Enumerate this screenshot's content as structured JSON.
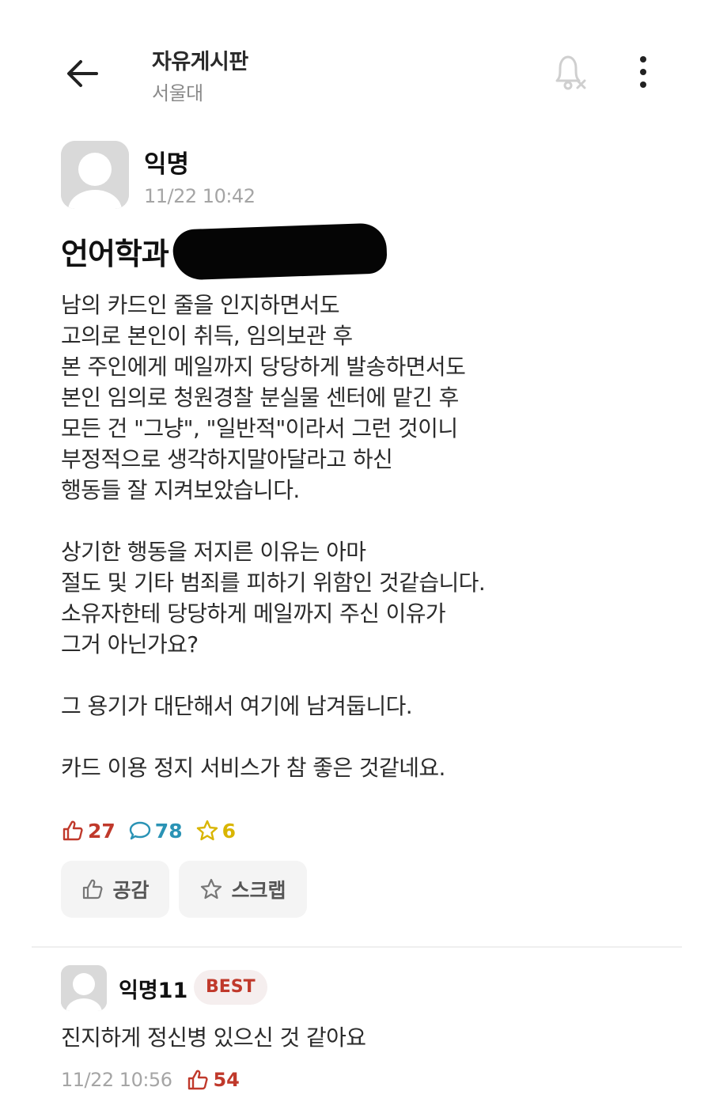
{
  "header": {
    "board_title": "자유게시판",
    "school": "서울대"
  },
  "post": {
    "author": "익명",
    "time": "11/22 10:42",
    "title_visible": "언어학과",
    "body_paragraphs": [
      [
        "남의 카드인 줄을 인지하면서도",
        "고의로 본인이 취득, 임의보관 후",
        "본 주인에게 메일까지 당당하게 발송하면서도",
        "본인 임의로 청원경찰 분실물 센터에 맡긴 후",
        "모든 건 \"그냥\", \"일반적\"이라서 그런 것이니",
        "부정적으로 생각하지말아달라고 하신",
        "행동들 잘 지켜보았습니다."
      ],
      [
        "상기한 행동을 저지른 이유는 아마",
        "절도 및 기타 범죄를 피하기 위함인 것같습니다.",
        "소유자한테 당당하게 메일까지 주신 이유가",
        "그거 아닌가요?"
      ],
      [
        "그 용기가 대단해서 여기에 남겨둡니다."
      ],
      [
        "카드 이용 정지 서비스가 참 좋은 것같네요."
      ]
    ],
    "stats": {
      "likes": "27",
      "comments": "78",
      "scraps": "6"
    }
  },
  "actions": {
    "like_label": "공감",
    "scrap_label": "스크랩"
  },
  "comment": {
    "author": "익명11",
    "badge": "BEST",
    "text": "진지하게 정신병 있으신 것 같아요",
    "time": "11/22 10:56",
    "likes": "54"
  },
  "colors": {
    "like": "#c0392b",
    "comment": "#2a93b5",
    "scrap": "#d9b500",
    "muted": "#a5a5a5"
  },
  "icons": [
    "back-arrow-icon",
    "bell-off-icon",
    "more-vertical-icon",
    "thumbs-up-icon",
    "speech-bubble-icon",
    "star-icon",
    "default-avatar-icon"
  ]
}
